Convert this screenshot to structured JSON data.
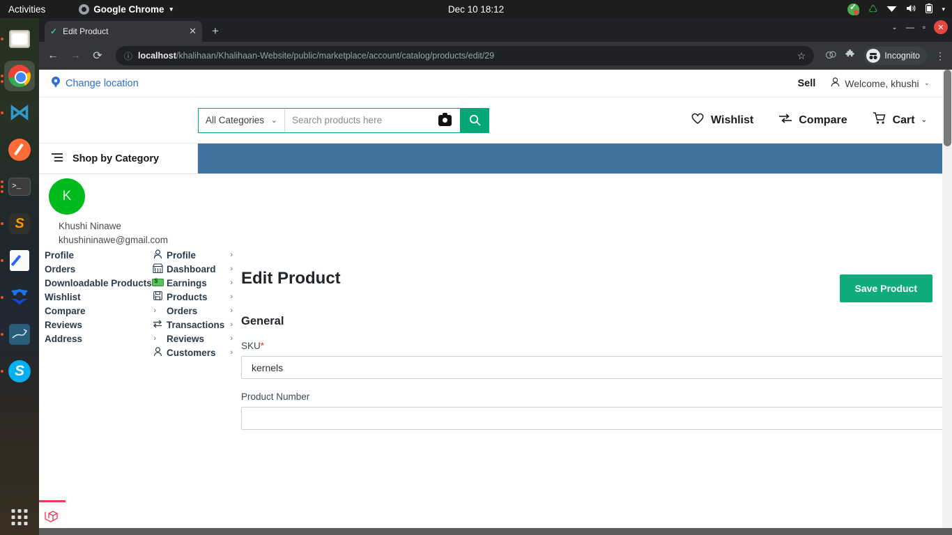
{
  "gnome": {
    "activities": "Activities",
    "app_name": "Google Chrome",
    "app_caret": "▾",
    "clock": "Dec 10  18:12",
    "tray": {
      "sync_icon": "♺",
      "wifi_icon": "▼",
      "volume_icon": "🔊",
      "battery_icon": "▯",
      "caret": "▾"
    }
  },
  "dock": {
    "items": [
      {
        "name": "files",
        "label": "Files"
      },
      {
        "name": "chrome",
        "label": "Google Chrome"
      },
      {
        "name": "vscode",
        "label": "Visual Studio Code"
      },
      {
        "name": "postman",
        "label": "Postman"
      },
      {
        "name": "terminal",
        "label": "Terminal"
      },
      {
        "name": "sublime",
        "label": "Sublime Text"
      },
      {
        "name": "text-editor",
        "label": "Text Editor"
      },
      {
        "name": "arrows-app",
        "label": "Arrows App"
      },
      {
        "name": "mysql-workbench",
        "label": "MySQL Workbench"
      },
      {
        "name": "skype",
        "label": "Skype"
      }
    ],
    "vscode_glyph": "⋈",
    "terminal_glyph": ">_",
    "sublime_glyph": "S",
    "arrows_glyph": "⬈",
    "mysql_glyph": "⚘",
    "skype_glyph": "S"
  },
  "chrome": {
    "tab": {
      "favicon": "✓",
      "title": "Edit Product",
      "close": "✕"
    },
    "new_tab": "+",
    "window_controls": {
      "minimize": "—",
      "maximize": "▫",
      "close": "✕",
      "dropdown": "⌄"
    },
    "toolbar": {
      "back": "←",
      "forward": "→",
      "reload": "⟳",
      "info_icon": "ⓘ",
      "url_host": "localhost",
      "url_path": "/khalihaan/Khalihaan-Website/public/marketplace/account/catalog/products/edit/29",
      "star": "☆",
      "cookie_icon": "◍",
      "extensions_icon": "🧩",
      "incognito_glyph": "👓",
      "incognito_label": "Incognito",
      "menu": "⋮"
    }
  },
  "site": {
    "util": {
      "pin_icon": "📍",
      "change_location": "Change location",
      "sell": "Sell",
      "person_icon": "👤",
      "welcome": "Welcome, khushi",
      "caret": "⌄"
    },
    "search": {
      "category_value": "All Categories",
      "category_caret": "⌄",
      "placeholder": "Search products here",
      "value": "",
      "camera_icon": "camera-icon",
      "search_icon": "⌕"
    },
    "nav_right": [
      {
        "icon": "♡",
        "label": "Wishlist"
      },
      {
        "icon": "⇥",
        "label": "Compare"
      },
      {
        "icon": "🛒",
        "label": "Cart",
        "caret": "⌄"
      }
    ],
    "category_bar": {
      "list_icon": "list-icon",
      "label": "Shop by Category",
      "banner_color": "#42739f"
    }
  },
  "account": {
    "avatar_initial": "K",
    "avatar_color": "#00bb1e",
    "name": "Khushi Ninawe",
    "email": "khushininawe@gmail.com",
    "menu_left": [
      {
        "label": "Profile",
        "chevron": "›"
      },
      {
        "label": "Orders",
        "chevron": "›"
      },
      {
        "label": "Downloadable Products",
        "chevron": "›"
      },
      {
        "label": "Wishlist",
        "chevron": "›"
      },
      {
        "label": "Compare",
        "chevron": "›"
      },
      {
        "label": "Reviews",
        "chevron": "›"
      },
      {
        "label": "Address",
        "chevron": "›"
      }
    ],
    "menu_right": [
      {
        "icon": "person",
        "label": "Profile",
        "chevron": "›"
      },
      {
        "icon": "store",
        "label": "Dashboard",
        "chevron": "›"
      },
      {
        "icon": "money",
        "label": "Earnings",
        "chevron": "›"
      },
      {
        "icon": "save",
        "label": "Products",
        "chevron": "›"
      },
      {
        "icon": "none",
        "label": "Orders",
        "chevron": "›"
      },
      {
        "icon": "transfer",
        "label": "Transactions",
        "chevron": "›"
      },
      {
        "icon": "none",
        "label": "Reviews",
        "chevron": "›"
      },
      {
        "icon": "person",
        "label": "Customers",
        "chevron": "›"
      }
    ]
  },
  "main": {
    "title": "Edit Product",
    "save_button": "Save Product",
    "save_button_color": "#0eab7b",
    "section_title": "General",
    "fields": [
      {
        "label": "SKU",
        "required": true,
        "required_mark": "*",
        "value": "kernels",
        "placeholder": ""
      },
      {
        "label": "Product Number",
        "required": false,
        "required_mark": "",
        "value": "",
        "placeholder": ""
      }
    ]
  },
  "taskbar": {
    "laravel_glyph": "◱"
  }
}
